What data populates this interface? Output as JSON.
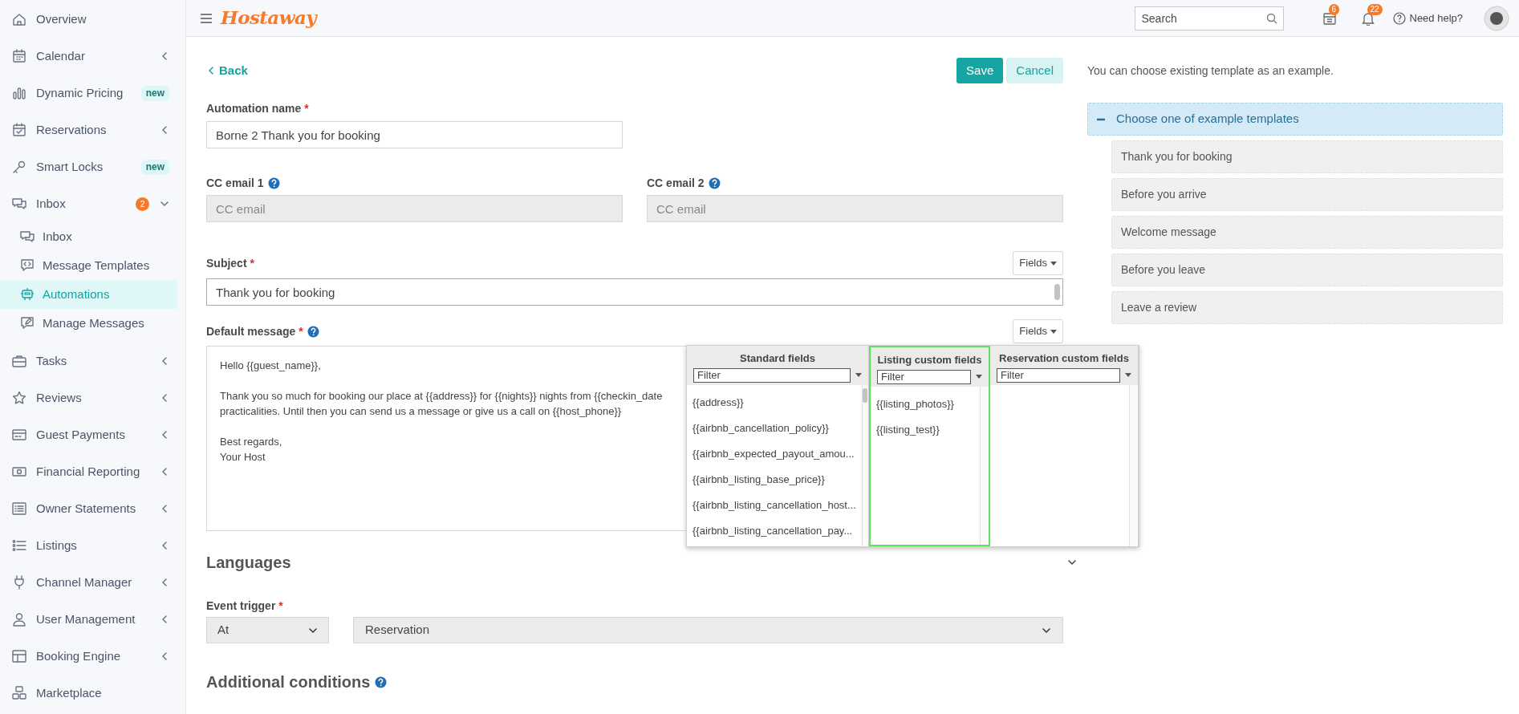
{
  "sidebar": {
    "items": [
      {
        "label": "Overview",
        "kind": "link",
        "selected": false
      },
      {
        "label": "Calendar",
        "kind": "group",
        "expanded": false,
        "selected": false
      },
      {
        "label": "Dynamic Pricing",
        "kind": "link",
        "badge": "new",
        "selected": false
      },
      {
        "label": "Reservations",
        "kind": "group",
        "expanded": false,
        "selected": false
      },
      {
        "label": "Smart Locks",
        "kind": "link",
        "badge": "new",
        "selected": false
      },
      {
        "label": "Inbox",
        "kind": "group",
        "expanded": true,
        "count": "2",
        "selected": false,
        "children": [
          {
            "label": "Inbox",
            "selected": false
          },
          {
            "label": "Message Templates",
            "selected": false
          },
          {
            "label": "Automations",
            "selected": true
          },
          {
            "label": "Manage Messages",
            "selected": false
          }
        ]
      },
      {
        "label": "Tasks",
        "kind": "group",
        "expanded": false,
        "selected": false
      },
      {
        "label": "Reviews",
        "kind": "group",
        "expanded": false,
        "selected": false
      },
      {
        "label": "Guest Payments",
        "kind": "group",
        "expanded": false,
        "selected": false
      },
      {
        "label": "Financial Reporting",
        "kind": "group",
        "expanded": false,
        "selected": false
      },
      {
        "label": "Owner Statements",
        "kind": "group",
        "expanded": false,
        "selected": false
      },
      {
        "label": "Listings",
        "kind": "group",
        "expanded": false,
        "selected": false
      },
      {
        "label": "Channel Manager",
        "kind": "group",
        "expanded": false,
        "selected": false
      },
      {
        "label": "User Management",
        "kind": "group",
        "expanded": false,
        "selected": false
      },
      {
        "label": "Booking Engine",
        "kind": "group",
        "expanded": false,
        "selected": false
      },
      {
        "label": "Marketplace",
        "kind": "link",
        "selected": false
      }
    ]
  },
  "topbar": {
    "logo": "Hostaway",
    "search": {
      "placeholder": "Search"
    },
    "calendar_badge": "6",
    "notification_badge": "22",
    "help": "Need help?"
  },
  "form": {
    "back": "Back",
    "buttons": [
      {
        "label": "Save",
        "kind": "primary"
      },
      {
        "label": "Cancel",
        "kind": "secondary"
      }
    ],
    "automation_name": {
      "label": "Automation name",
      "required_mark": "*",
      "value": "Borne 2 Thank you for booking"
    },
    "cc_emails": [
      {
        "label": "CC email 1",
        "help": true,
        "placeholder": "CC email",
        "disabled": true
      },
      {
        "label": "CC email 2",
        "help": true,
        "placeholder": "CC email",
        "disabled": true
      }
    ],
    "subject": {
      "label": "Subject",
      "required_mark": "*",
      "fields_button": "Fields",
      "value": "Thank you for booking"
    },
    "default_message": {
      "label": "Default message",
      "required_mark": "*",
      "help": true,
      "fields_button": "Fields",
      "paragraphs": [
        [
          "Hello {{guest_name}},"
        ],
        [
          "Thank you so much for booking our place at {{address}} for {{nights}} nights from {{checkin_date",
          "practicalities. Until then you can send us a message or give us a call on {{host_phone}}"
        ],
        [
          "Best regards,",
          "Your Host"
        ]
      ]
    },
    "fields_popup": {
      "columns": [
        {
          "title": "Standard fields",
          "filter_placeholder": "Filter",
          "selected": false,
          "items": [
            "{{address}}",
            "{{airbnb_cancellation_policy}}",
            "{{airbnb_expected_payout_amou...",
            "{{airbnb_listing_base_price}}",
            "{{airbnb_listing_cancellation_host...",
            "{{airbnb_listing_cancellation_pay..."
          ]
        },
        {
          "title": "Listing custom fields",
          "filter_placeholder": "Filter",
          "selected": true,
          "items": [
            "{{listing_photos}}",
            "{{listing_test}}"
          ]
        },
        {
          "title": "Reservation custom fields",
          "filter_placeholder": "Filter",
          "selected": false
        }
      ]
    },
    "languages": {
      "title": "Languages",
      "expanded": false
    },
    "event_trigger": {
      "label": "Event trigger",
      "required_mark": "*",
      "selects": [
        "At",
        "Reservation"
      ]
    },
    "additional_conditions": {
      "title": "Additional conditions",
      "help": true
    }
  },
  "templates": {
    "hint": "You can choose existing template as an example.",
    "accordion": {
      "title": "Choose one of example templates",
      "expanded": true,
      "items": [
        "Thank you for booking",
        "Before you arrive",
        "Welcome message",
        "Before you leave",
        "Leave a review"
      ]
    }
  }
}
